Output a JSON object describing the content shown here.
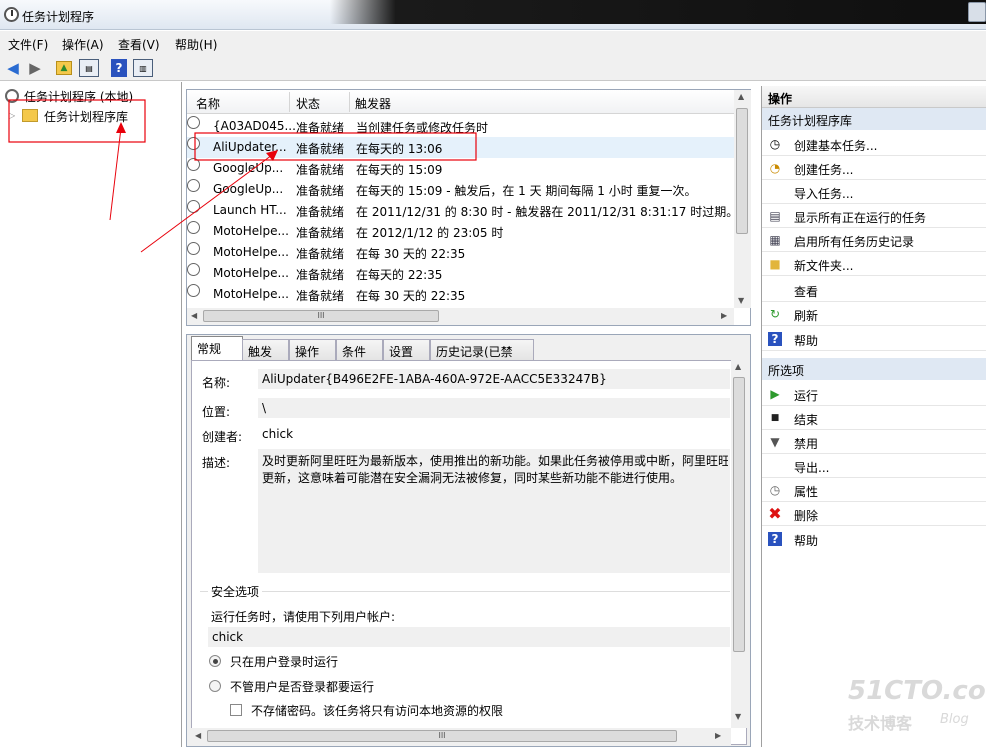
{
  "window": {
    "title": "任务计划程序"
  },
  "menu": [
    "文件(F)",
    "操作(A)",
    "查看(V)",
    "帮助(H)"
  ],
  "toolbar": {
    "icons": [
      "back-arrow-icon",
      "forward-arrow-icon",
      "folder-up-icon",
      "console-tree-icon",
      "help-icon",
      "action-pane-icon"
    ]
  },
  "tree": {
    "root": "任务计划程序 (本地)",
    "library": "任务计划程序库"
  },
  "tasklist": {
    "columns": [
      "名称",
      "状态",
      "触发器"
    ],
    "rows": [
      {
        "name": "{A03AD045...",
        "status": "准备就绪",
        "trigger": "当创建任务或修改任务时"
      },
      {
        "name": "AliUpdater...",
        "status": "准备就绪",
        "trigger": "在每天的 13:06"
      },
      {
        "name": "GoogleUp...",
        "status": "准备就绪",
        "trigger": "在每天的 15:09"
      },
      {
        "name": "GoogleUp...",
        "status": "准备就绪",
        "trigger": "在每天的 15:09 - 触发后，在 1 天 期间每隔 1 小时 重复一次。"
      },
      {
        "name": "Launch HT...",
        "status": "准备就绪",
        "trigger": "在 2011/12/31 的 8:30 时 - 触发器在 2011/12/31 8:31:17 时过期。"
      },
      {
        "name": "MotoHelpe...",
        "status": "准备就绪",
        "trigger": "在 2012/1/12 的 23:05 时"
      },
      {
        "name": "MotoHelpe...",
        "status": "准备就绪",
        "trigger": "在每 30 天的 22:35"
      },
      {
        "name": "MotoHelpe...",
        "status": "准备就绪",
        "trigger": "在每天的 22:35"
      },
      {
        "name": "MotoHelpe...",
        "status": "准备就绪",
        "trigger": "在每 30 天的 22:35"
      }
    ],
    "scroll_grip": "III"
  },
  "detail": {
    "tabs": [
      "常规",
      "触发器",
      "操作",
      "条件",
      "设置",
      "历史记录(已禁用)"
    ],
    "name_label": "名称:",
    "name_value": "AliUpdater{B496E2FE-1ABA-460A-972E-AACC5E33247B}",
    "location_label": "位置:",
    "location_value": "\\",
    "author_label": "创建者:",
    "author_value": "chick",
    "desc_label": "描述:",
    "desc_line1": "及时更新阿里旺旺为最新版本，使用推出的新功能。如果此任务被停用或中断，阿里旺旺",
    "desc_line2": "更新，这意味着可能潜在安全漏洞无法被修复，同时某些新功能不能进行使用。",
    "security_title": "安全选项",
    "run_as_label": "运行任务时，请使用下列用户帐户:",
    "run_as_value": "chick",
    "opt_logged_on": "只在用户登录时运行",
    "opt_any": "不管用户是否登录都要运行",
    "opt_nopwd": "不存储密码。该任务将只有访问本地资源的权限",
    "scroll_grip": "III"
  },
  "actions": {
    "header": "操作",
    "section": "任务计划程序库",
    "items": [
      "创建基本任务...",
      "创建任务...",
      "导入任务...",
      "显示所有正在运行的任务",
      "启用所有任务历史记录",
      "新文件夹...",
      "查看",
      "刷新",
      "帮助"
    ],
    "selected_header": "所选项",
    "selected_items": [
      "运行",
      "结束",
      "禁用",
      "导出...",
      "属性",
      "删除",
      "帮助"
    ]
  },
  "watermark": {
    "line1": "51CTO.com",
    "line2": "技术博客",
    "line3": "Blog"
  },
  "colors": {
    "annotation": "#e8000b",
    "selection": "#e5f1fb",
    "section_header": "#dfe8f3"
  }
}
